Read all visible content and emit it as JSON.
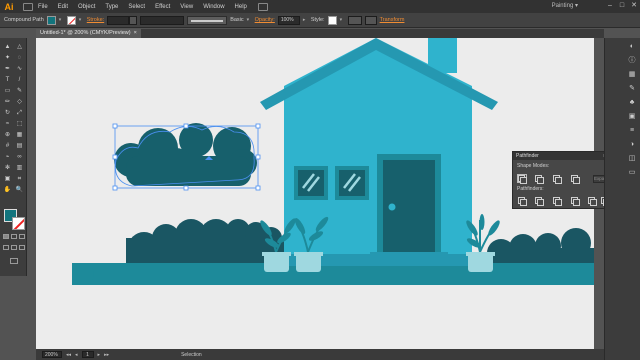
{
  "app": {
    "logo": "Ai",
    "menus": [
      "File",
      "Edit",
      "Object",
      "Type",
      "Select",
      "Effect",
      "View",
      "Window",
      "Help"
    ],
    "workspace": "Painting",
    "workspace_caret": "▾",
    "window_controls": [
      "–",
      "□",
      "✕"
    ]
  },
  "controlbar": {
    "selection_type": "Compound Path",
    "fill_color": "#12747d",
    "stroke_label": "Stroke:",
    "brush_label": "Basic",
    "opacity_label": "Opacity:",
    "opacity_value": "100%",
    "style_label": "Style:",
    "transform_label": "Transform"
  },
  "document": {
    "tab_title": "Untitled-1* @ 200% (CMYK/Preview)",
    "close": "×"
  },
  "toolbar": {
    "tools": [
      "selection-tool",
      "direct-selection-tool",
      "magic-wand-tool",
      "lasso-tool",
      "pen-tool",
      "curvature-tool",
      "type-tool",
      "line-tool",
      "rectangle-tool",
      "paintbrush-tool",
      "pencil-tool",
      "eraser-tool",
      "rotate-tool",
      "scale-tool",
      "width-tool",
      "free-transform-tool",
      "shape-builder-tool",
      "perspective-grid-tool",
      "mesh-tool",
      "gradient-tool",
      "eyedropper-tool",
      "blend-tool",
      "symbol-sprayer-tool",
      "column-graph-tool",
      "artboard-tool",
      "slice-tool",
      "hand-tool",
      "zoom-tool"
    ],
    "tool_glyphs": [
      "▲",
      "△",
      "✦",
      "◌",
      "✒",
      "∿",
      "T",
      "/",
      "▭",
      "✎",
      "✏",
      "◇",
      "↻",
      "⤢",
      "≈",
      "⬚",
      "⊕",
      "▦",
      "#",
      "▤",
      "⌁",
      "∞",
      "✻",
      "▥",
      "▣",
      "⌗",
      "✋",
      "🔍"
    ],
    "fill_color": "#12747d"
  },
  "pathfinder": {
    "title": "Pathfinder",
    "menu": "≡",
    "shape_modes_label": "Shape Modes:",
    "pathfinders_label": "Pathfinders:",
    "expand_label": "Expand"
  },
  "statusbar": {
    "zoom": "200%",
    "page": "1",
    "tool": "Selection",
    "first": "◂◂",
    "prev": "◂",
    "next": "▸",
    "last": "▸▸"
  },
  "colors": {
    "house": "#2fb3cd",
    "roof": "#2598b1",
    "dark_teal": "#17606c",
    "ground": "#1d8a9a",
    "bush_dark": "#1a5663",
    "pot": "#9fd8e0",
    "canvas": "#ececec",
    "accent_orange": "#f08c33",
    "selection_blue": "#4a8ff0"
  }
}
